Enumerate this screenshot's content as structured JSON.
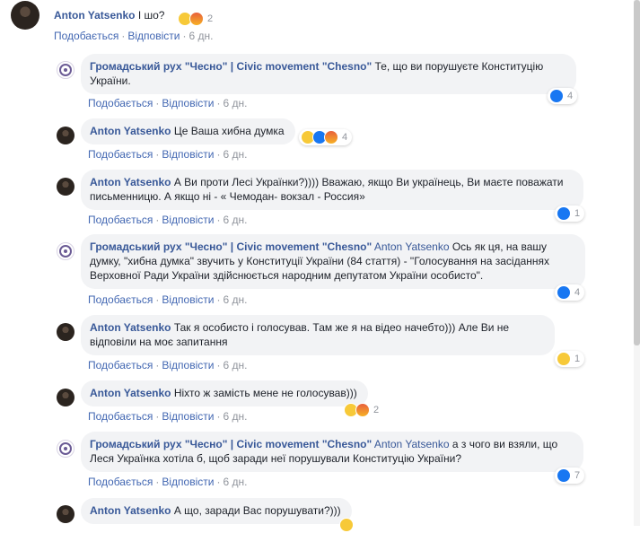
{
  "thread": {
    "actions": {
      "like": "Подобається",
      "reply": "Відповісти",
      "sep": "·"
    },
    "top": {
      "author": "Anton Yatsenko",
      "text": "І шо?",
      "time": "6 дн.",
      "reactions": {
        "icons": [
          "haha",
          "angry"
        ],
        "count": "2"
      }
    },
    "replies": [
      {
        "author": "Громадський рух \"Чесно\" | Civic movement \"Chesno\"",
        "text": "Те, що ви порушуєте Конституцію України.",
        "time": "6 дн.",
        "avatar": "org",
        "reactions": {
          "icons": [
            "like"
          ],
          "count": "4"
        }
      },
      {
        "author": "Anton Yatsenko",
        "text": "Це Ваша хибна думка",
        "time": "6 дн.",
        "avatar": "user",
        "reactions": {
          "icons": [
            "haha",
            "like",
            "angry"
          ],
          "count": "4"
        }
      },
      {
        "author": "Anton Yatsenko",
        "text": "А Ви проти Лесі Українки?)))) Вважаю, якщо Ви українець, Ви маєте поважати письменницю. А якщо ні - « Чемодан- вокзал - Россия»",
        "time": "6 дн.",
        "avatar": "user",
        "reactions": {
          "icons": [
            "like"
          ],
          "count": "1"
        }
      },
      {
        "author": "Громадський рух \"Чесно\" | Civic movement \"Chesno\"",
        "mention": "Anton Yatsenko",
        "text": "Ось як ця, на вашу думку, \"хибна думка\" звучить у Конституції України (84 стаття) - \"Голосування на засіданнях Верховної Ради України здійснюється народним депутатом України особисто\".",
        "time": "6 дн.",
        "avatar": "org",
        "reactions": {
          "icons": [
            "like"
          ],
          "count": "4"
        }
      },
      {
        "author": "Anton Yatsenko",
        "text": "Так я особисто і голосував. Там же я на відео начебто))) Але Ви не відповіли на моє запитання",
        "time": "6 дн.",
        "avatar": "user",
        "reactions": {
          "icons": [
            "haha"
          ],
          "count": "1"
        }
      },
      {
        "author": "Anton Yatsenko",
        "text": "Ніхто ж замість мене не голосував)))",
        "time": "6 дн.",
        "avatar": "user",
        "reactions": {
          "icons": [
            "haha",
            "angry"
          ],
          "count": "2"
        }
      },
      {
        "author": "Громадський рух \"Чесно\" | Civic movement \"Chesno\"",
        "mention": "Anton Yatsenko",
        "text": "а з чого ви взяли, що Леся Українка хотіла б, щоб заради неї порушували Конституцію України?",
        "time": "6 дн.",
        "avatar": "org",
        "reactions": {
          "icons": [
            "like"
          ],
          "count": "7"
        }
      },
      {
        "author": "Anton Yatsenko",
        "text": "А що, заради Вас порушувати?)))",
        "time": "",
        "avatar": "user",
        "reactions": {
          "icons": [
            "haha"
          ],
          "count": ""
        }
      }
    ]
  }
}
